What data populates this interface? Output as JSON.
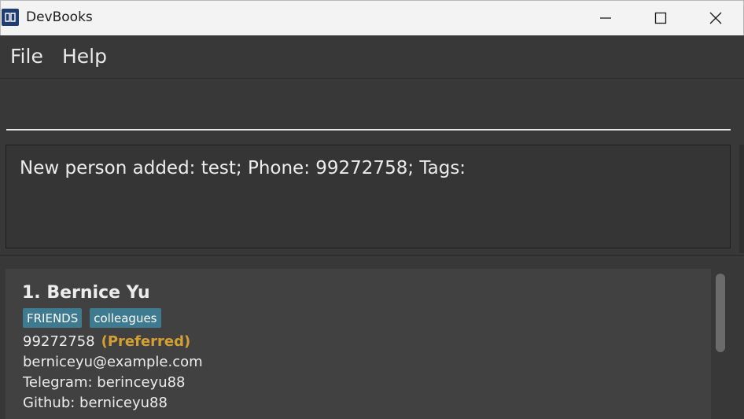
{
  "window": {
    "title": "DevBooks",
    "icons": {
      "app": "book-icon",
      "minimize": "minimize-icon",
      "maximize": "maximize-icon",
      "close": "close-icon"
    }
  },
  "menu": {
    "file_label": "File",
    "help_label": "Help"
  },
  "command": {
    "value": "",
    "placeholder": ""
  },
  "result": {
    "message": "New person added: test; Phone: 99272758; Tags:"
  },
  "persons": [
    {
      "title": "1. Bernice Yu",
      "tags": [
        "FRIENDS",
        "colleagues"
      ],
      "phone": "99272758",
      "preferred": "(Preferred)",
      "email": "berniceyu@example.com",
      "telegram": "Telegram: berinceyu88",
      "github": "Github: berniceyu88"
    }
  ],
  "colors": {
    "tag_background": "#3e7b91",
    "preferred_text": "#d4a033",
    "app_background": "#383838"
  }
}
